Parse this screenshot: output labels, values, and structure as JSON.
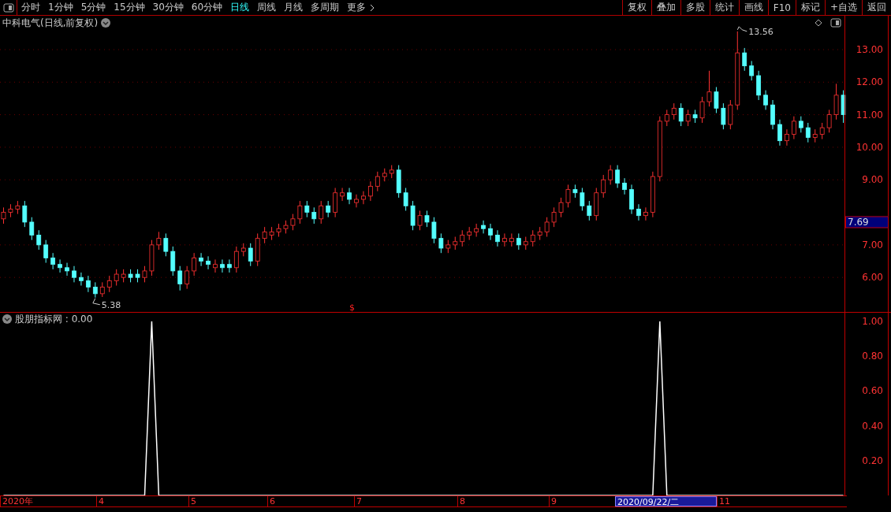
{
  "toolbar": {
    "periods": [
      {
        "label": "分时",
        "selected": false
      },
      {
        "label": "1分钟",
        "selected": false
      },
      {
        "label": "5分钟",
        "selected": false
      },
      {
        "label": "15分钟",
        "selected": false
      },
      {
        "label": "30分钟",
        "selected": false
      },
      {
        "label": "60分钟",
        "selected": false
      },
      {
        "label": "日线",
        "selected": true
      },
      {
        "label": "周线",
        "selected": false
      },
      {
        "label": "月线",
        "selected": false
      },
      {
        "label": "多周期",
        "selected": false
      },
      {
        "label": "更多",
        "selected": false
      }
    ],
    "buttons": [
      "复权",
      "叠加",
      "多股",
      "统计",
      "画线",
      "F10",
      "标记",
      "+自选",
      "返回"
    ]
  },
  "main_chart": {
    "title": "中科电气(日线,前复权)",
    "current_price": "7.69",
    "high_label": "13.56",
    "low_label": "5.38",
    "marker": "$",
    "chart_data": {
      "type": "candlestick",
      "grid": true,
      "ylim": [
        4.94,
        14.04
      ],
      "yticks": [
        {
          "value": 13,
          "label": "13.00"
        },
        {
          "value": 12,
          "label": "12.00"
        },
        {
          "value": 11,
          "label": "11.00"
        },
        {
          "value": 10,
          "label": "10.00"
        },
        {
          "value": 9,
          "label": "9.00"
        },
        {
          "value": 7,
          "label": "7.00"
        },
        {
          "value": 6,
          "label": "6.00"
        }
      ],
      "categories": [
        null,
        null,
        null,
        null,
        null,
        null,
        null,
        null,
        null,
        null,
        null,
        null,
        null,
        null,
        null,
        null,
        null,
        null,
        null,
        null,
        null,
        null,
        null,
        null,
        null,
        null,
        null,
        null,
        null,
        null,
        null,
        null,
        null,
        null,
        null,
        null,
        null,
        null,
        null,
        null,
        null,
        null,
        null,
        null,
        null,
        null,
        null,
        null,
        null,
        null,
        null,
        null,
        null,
        null,
        null,
        null,
        null,
        null,
        null,
        null,
        null,
        null,
        null,
        null,
        null,
        null,
        null,
        null,
        null,
        null,
        null,
        null,
        null,
        null,
        null,
        null,
        null,
        null,
        null,
        null,
        null,
        null,
        null,
        null,
        null,
        null,
        null,
        null,
        null,
        null,
        null,
        null,
        null,
        null,
        null,
        null,
        null,
        null,
        null,
        null,
        null,
        null,
        null,
        null,
        null,
        null,
        null,
        null,
        null,
        null,
        null,
        null,
        null,
        null,
        null,
        null,
        null,
        null,
        null,
        null
      ],
      "ohlc": [
        [
          7.8,
          8.15,
          7.65,
          8.0
        ],
        [
          8.0,
          8.25,
          7.85,
          8.1
        ],
        [
          8.1,
          8.35,
          7.95,
          8.2
        ],
        [
          8.2,
          8.35,
          7.55,
          7.7
        ],
        [
          7.7,
          7.85,
          7.15,
          7.3
        ],
        [
          7.3,
          7.45,
          6.85,
          7.0
        ],
        [
          7.0,
          7.15,
          6.45,
          6.6
        ],
        [
          6.6,
          6.75,
          6.25,
          6.4
        ],
        [
          6.4,
          6.55,
          6.15,
          6.3
        ],
        [
          6.3,
          6.45,
          6.05,
          6.2
        ],
        [
          6.2,
          6.35,
          5.85,
          6.0
        ],
        [
          6.0,
          6.15,
          5.75,
          5.9
        ],
        [
          5.9,
          6.05,
          5.55,
          5.7
        ],
        [
          5.7,
          5.85,
          5.38,
          5.5
        ],
        [
          5.5,
          5.85,
          5.4,
          5.7
        ],
        [
          5.7,
          6.05,
          5.55,
          5.9
        ],
        [
          5.9,
          6.25,
          5.75,
          6.1
        ],
        [
          6.0,
          6.25,
          5.85,
          6.1
        ],
        [
          6.1,
          6.25,
          5.85,
          6.0
        ],
        [
          6.1,
          6.25,
          5.85,
          6.0
        ],
        [
          6.0,
          6.35,
          5.85,
          6.2
        ],
        [
          6.2,
          7.15,
          6.05,
          7.0
        ],
        [
          7.0,
          7.4,
          6.85,
          7.2
        ],
        [
          7.2,
          7.35,
          6.65,
          6.8
        ],
        [
          6.8,
          6.95,
          6.05,
          6.2
        ],
        [
          6.2,
          6.35,
          5.6,
          5.8
        ],
        [
          5.8,
          6.35,
          5.65,
          6.2
        ],
        [
          6.2,
          6.75,
          6.05,
          6.6
        ],
        [
          6.6,
          6.75,
          6.35,
          6.5
        ],
        [
          6.5,
          6.65,
          6.25,
          6.4
        ],
        [
          6.3,
          6.55,
          6.15,
          6.4
        ],
        [
          6.4,
          6.55,
          6.15,
          6.3
        ],
        [
          6.4,
          6.55,
          6.15,
          6.3
        ],
        [
          6.3,
          6.95,
          6.15,
          6.8
        ],
        [
          6.8,
          7.05,
          6.65,
          6.9
        ],
        [
          6.9,
          7.05,
          6.35,
          6.5
        ],
        [
          6.5,
          7.35,
          6.35,
          7.2
        ],
        [
          7.2,
          7.55,
          7.05,
          7.4
        ],
        [
          7.3,
          7.55,
          7.15,
          7.4
        ],
        [
          7.4,
          7.65,
          7.25,
          7.5
        ],
        [
          7.5,
          7.75,
          7.35,
          7.6
        ],
        [
          7.6,
          7.95,
          7.45,
          7.8
        ],
        [
          7.8,
          8.35,
          7.65,
          8.2
        ],
        [
          8.2,
          8.35,
          7.85,
          8.0
        ],
        [
          8.0,
          8.15,
          7.65,
          7.8
        ],
        [
          7.8,
          8.35,
          7.65,
          8.2
        ],
        [
          8.2,
          8.35,
          7.85,
          8.0
        ],
        [
          8.0,
          8.75,
          7.85,
          8.6
        ],
        [
          8.5,
          8.75,
          8.35,
          8.6
        ],
        [
          8.6,
          8.75,
          8.25,
          8.4
        ],
        [
          8.3,
          8.55,
          8.15,
          8.4
        ],
        [
          8.4,
          8.65,
          8.25,
          8.5
        ],
        [
          8.5,
          8.95,
          8.35,
          8.8
        ],
        [
          8.8,
          9.25,
          8.65,
          9.1
        ],
        [
          9.1,
          9.35,
          8.95,
          9.2
        ],
        [
          9.2,
          9.45,
          9.05,
          9.3
        ],
        [
          9.3,
          9.45,
          8.45,
          8.6
        ],
        [
          8.6,
          8.75,
          8.05,
          8.2
        ],
        [
          8.2,
          8.35,
          7.45,
          7.6
        ],
        [
          7.6,
          8.05,
          7.45,
          7.9
        ],
        [
          7.9,
          8.05,
          7.55,
          7.7
        ],
        [
          7.7,
          7.85,
          7.05,
          7.2
        ],
        [
          7.2,
          7.35,
          6.75,
          6.9
        ],
        [
          6.9,
          7.15,
          6.75,
          7.0
        ],
        [
          7.0,
          7.25,
          6.85,
          7.1
        ],
        [
          7.1,
          7.45,
          6.95,
          7.3
        ],
        [
          7.3,
          7.55,
          7.15,
          7.4
        ],
        [
          7.4,
          7.65,
          7.25,
          7.5
        ],
        [
          7.6,
          7.75,
          7.35,
          7.5
        ],
        [
          7.5,
          7.65,
          7.15,
          7.3
        ],
        [
          7.3,
          7.45,
          6.95,
          7.1
        ],
        [
          7.1,
          7.35,
          6.95,
          7.2
        ],
        [
          7.1,
          7.35,
          6.95,
          7.2
        ],
        [
          7.2,
          7.35,
          6.85,
          7.0
        ],
        [
          7.0,
          7.25,
          6.85,
          7.1
        ],
        [
          7.1,
          7.45,
          6.95,
          7.3
        ],
        [
          7.3,
          7.55,
          7.15,
          7.4
        ],
        [
          7.4,
          7.85,
          7.25,
          7.7
        ],
        [
          7.7,
          8.15,
          7.55,
          8.0
        ],
        [
          8.0,
          8.45,
          7.85,
          8.3
        ],
        [
          8.3,
          8.85,
          8.15,
          8.7
        ],
        [
          8.7,
          8.85,
          8.45,
          8.6
        ],
        [
          8.6,
          8.75,
          8.05,
          8.2
        ],
        [
          8.2,
          8.35,
          7.75,
          7.9
        ],
        [
          7.9,
          8.75,
          7.75,
          8.6
        ],
        [
          8.6,
          9.15,
          8.45,
          9.0
        ],
        [
          9.0,
          9.45,
          8.85,
          9.3
        ],
        [
          9.3,
          9.45,
          8.75,
          8.9
        ],
        [
          8.9,
          9.05,
          8.55,
          8.7
        ],
        [
          8.7,
          8.85,
          7.95,
          8.1
        ],
        [
          8.1,
          8.25,
          7.75,
          7.9
        ],
        [
          7.9,
          8.15,
          7.75,
          8.0
        ],
        [
          8.0,
          9.25,
          7.85,
          9.1
        ],
        [
          9.1,
          10.95,
          8.95,
          10.8
        ],
        [
          10.8,
          11.15,
          10.65,
          11.0
        ],
        [
          11.0,
          11.35,
          10.85,
          11.2
        ],
        [
          11.2,
          11.35,
          10.65,
          10.8
        ],
        [
          10.8,
          11.15,
          10.65,
          11.0
        ],
        [
          11.0,
          11.15,
          10.75,
          10.9
        ],
        [
          10.9,
          11.55,
          10.75,
          11.4
        ],
        [
          11.4,
          12.35,
          11.25,
          11.7
        ],
        [
          11.7,
          11.85,
          11.05,
          11.2
        ],
        [
          11.2,
          11.35,
          10.55,
          10.7
        ],
        [
          10.7,
          11.45,
          10.55,
          11.3
        ],
        [
          11.3,
          13.56,
          11.15,
          12.9
        ],
        [
          12.9,
          13.05,
          12.35,
          12.5
        ],
        [
          12.5,
          12.65,
          12.05,
          12.2
        ],
        [
          12.2,
          12.35,
          11.45,
          11.6
        ],
        [
          11.6,
          11.75,
          11.15,
          11.3
        ],
        [
          11.3,
          11.45,
          10.55,
          10.7
        ],
        [
          10.7,
          10.85,
          10.05,
          10.2
        ],
        [
          10.2,
          10.55,
          10.05,
          10.4
        ],
        [
          10.4,
          10.95,
          10.25,
          10.8
        ],
        [
          10.8,
          10.95,
          10.45,
          10.6
        ],
        [
          10.6,
          10.75,
          10.15,
          10.3
        ],
        [
          10.3,
          10.55,
          10.15,
          10.4
        ],
        [
          10.4,
          10.75,
          10.25,
          10.6
        ],
        [
          10.6,
          11.15,
          10.45,
          11.0
        ],
        [
          11.0,
          11.95,
          10.85,
          11.6
        ],
        [
          11.6,
          11.75,
          10.75,
          11.0
        ]
      ]
    }
  },
  "indicator": {
    "label": "股朋指标网 : 0.00",
    "chart_data": {
      "type": "line",
      "ylim": [
        0,
        1.05
      ],
      "yticks": [
        {
          "value": 1,
          "label": "1.00"
        },
        {
          "value": 0.8,
          "label": "0.80"
        },
        {
          "value": 0.6,
          "label": "0.60"
        },
        {
          "value": 0.4,
          "label": "0.40"
        },
        {
          "value": 0.2,
          "label": "0.20"
        }
      ],
      "categories": [
        null,
        null,
        null,
        null,
        null,
        null,
        null,
        null,
        null,
        null,
        null,
        null,
        null,
        null,
        null,
        null,
        null,
        null,
        null,
        null,
        null,
        null,
        null,
        null,
        null,
        null,
        null,
        null,
        null,
        null,
        null,
        null,
        null,
        null,
        null,
        null,
        null,
        null,
        null,
        null,
        null,
        null,
        null,
        null,
        null,
        null,
        null,
        null,
        null,
        null,
        null,
        null,
        null,
        null,
        null,
        null,
        null,
        null,
        null,
        null,
        null,
        null,
        null,
        null,
        null,
        null,
        null,
        null,
        null,
        null,
        null,
        null,
        null,
        null,
        null,
        null,
        null,
        null,
        null,
        null,
        null,
        null,
        null,
        null,
        null,
        null,
        null,
        null,
        null,
        null,
        null,
        null,
        null,
        null,
        null,
        null,
        null,
        null,
        null,
        null,
        null,
        null,
        null,
        null,
        null,
        null,
        null,
        null,
        null,
        null,
        null,
        null,
        null,
        null,
        null,
        null,
        null,
        null,
        null,
        null
      ],
      "series": [
        {
          "color": "#ffffff",
          "values": [
            0,
            0,
            0,
            0,
            0,
            0,
            0,
            0,
            0,
            0,
            0,
            0,
            0,
            0,
            0,
            0,
            0,
            0,
            0,
            0,
            0,
            1,
            0,
            0,
            0,
            0,
            0,
            0,
            0,
            0,
            0,
            0,
            0,
            0,
            0,
            0,
            0,
            0,
            0,
            0,
            0,
            0,
            0,
            0,
            0,
            0,
            0,
            0,
            0,
            0,
            0,
            0,
            0,
            0,
            0,
            0,
            0,
            0,
            0,
            0,
            0,
            0,
            0,
            0,
            0,
            0,
            0,
            0,
            0,
            0,
            0,
            0,
            0,
            0,
            0,
            0,
            0,
            0,
            0,
            0,
            0,
            0,
            0,
            0,
            0,
            0,
            0,
            0,
            0,
            0,
            0,
            0,
            0,
            1,
            0,
            0,
            0,
            0,
            0,
            0,
            0,
            0,
            0,
            0,
            0,
            0,
            0,
            0,
            0,
            0,
            0,
            0,
            0,
            0,
            0,
            0,
            0,
            0,
            0,
            0
          ]
        }
      ]
    }
  },
  "date_axis": [
    {
      "label": "2020年",
      "selected": false
    },
    {
      "label": "4",
      "selected": false
    },
    {
      "label": "5",
      "selected": false
    },
    {
      "label": "6",
      "selected": false
    },
    {
      "label": "7",
      "selected": false
    },
    {
      "label": "8",
      "selected": false
    },
    {
      "label": "9",
      "selected": false
    },
    {
      "label": "2020/09/22/二",
      "selected": true
    },
    {
      "label": "11",
      "selected": false
    }
  ]
}
